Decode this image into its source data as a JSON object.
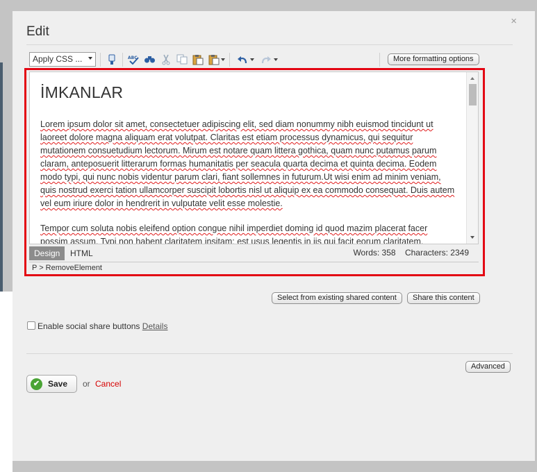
{
  "dialog": {
    "title": "Edit",
    "close_glyph": "×"
  },
  "toolbar": {
    "apply_css_label": "Apply CSS ...",
    "more_formatting_label": "More formatting options",
    "icons": [
      "format-painter-icon",
      "spellcheck-icon",
      "find-replace-icon",
      "cut-icon",
      "copy-icon",
      "paste-icon",
      "paste-special-icon",
      "undo-icon",
      "redo-icon"
    ]
  },
  "editor": {
    "heading": "İMKANLAR",
    "paragraph1": "Lorem ipsum dolor sit amet, consectetuer adipiscing elit, sed diam nonummy nibh euismod tincidunt ut laoreet dolore magna aliquam erat volutpat. Claritas est etiam processus dynamicus, qui sequitur mutationem consuetudium lectorum. Mirum est notare quam littera gothica, quam nunc putamus parum claram, anteposuerit litterarum formas humanitatis per seacula quarta decima et quinta decima. Eodem modo typi, qui nunc nobis videntur parum clari, fiant sollemnes in futurum.Ut wisi enim ad minim veniam, quis nostrud exerci tation ullamcorper suscipit lobortis nisl ut aliquip ex ea commodo consequat. Duis autem vel eum iriure dolor in hendrerit in vulputate velit esse molestie.",
    "paragraph2": "Tempor cum soluta nobis eleifend option congue nihil imperdiet doming id quod mazim placerat facer possim assum. Typi non habent claritatem insitam; est usus legentis in iis qui facit eorum claritatem.",
    "design_tab": "Design",
    "html_tab": "HTML",
    "words": "Words: 358",
    "characters": "Characters: 2349",
    "path": "P > RemoveElement"
  },
  "shared": {
    "select_existing_label": "Select from existing shared content",
    "share_label": "Share this content"
  },
  "social": {
    "checked": false,
    "label": "Enable social share buttons",
    "details_link": "Details"
  },
  "footer": {
    "advanced_label": "Advanced",
    "save_label": "Save",
    "or_text": "or",
    "cancel_label": "Cancel"
  },
  "colors": {
    "highlight_border": "#e30613",
    "cancel_link": "#d60000",
    "save_check": "#4aa435"
  }
}
